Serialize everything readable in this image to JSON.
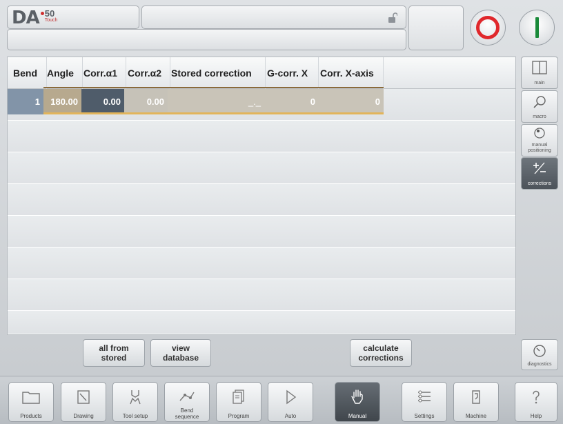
{
  "header": {
    "logo_text": "DA",
    "logo_model": "50",
    "logo_sub": "Touch",
    "title": "",
    "status": "",
    "lock_icon": "unlocked-padlock-icon",
    "stop_icon": "stop-ring-icon",
    "start_icon": "start-bar-icon",
    "colors": {
      "stop": "#e0282c",
      "start": "#1a8a3a"
    }
  },
  "table": {
    "columns": [
      "Bend",
      "Angle",
      "Corr.α1",
      "Corr.α2",
      "Stored correction",
      "G-corr. X",
      "Corr. X-axis"
    ],
    "rows": [
      {
        "bend": "1",
        "angle": "180.00",
        "corr_a1": "0.00",
        "corr_a2": "0.00",
        "stored": "_._",
        "gcorr_x": "0",
        "corr_x": "0"
      }
    ]
  },
  "actions": {
    "all_from_stored": "all from\nstored",
    "view_database": "view\ndatabase",
    "calculate_corrections": "calculate\ncorrections"
  },
  "sidebar": [
    {
      "label": "main",
      "icon": "main-panel-icon",
      "active": false
    },
    {
      "label": "macro",
      "icon": "magnifier-icon",
      "active": false
    },
    {
      "label": "manual positioning",
      "icon": "manual-positioning-icon",
      "active": false
    },
    {
      "label": "corrections",
      "icon": "plus-minus-icon",
      "active": true
    },
    {
      "label": "diagnostics",
      "icon": "diagnostics-gauge-icon",
      "active": false
    }
  ],
  "nav": [
    {
      "label": "Products",
      "icon": "folder-icon",
      "active": false
    },
    {
      "label": "Drawing",
      "icon": "drawing-icon",
      "active": false
    },
    {
      "label": "Tool setup",
      "icon": "tool-setup-icon",
      "active": false
    },
    {
      "label": "Bend sequence",
      "icon": "bend-sequence-icon",
      "active": false
    },
    {
      "label": "Program",
      "icon": "program-icon",
      "active": false
    },
    {
      "label": "Auto",
      "icon": "play-icon",
      "active": false
    },
    {
      "label": "Manual",
      "icon": "hand-icon",
      "active": true
    },
    {
      "label": "Settings",
      "icon": "settings-list-icon",
      "active": false
    },
    {
      "label": "Machine",
      "icon": "machine-icon",
      "active": false
    },
    {
      "label": "Help",
      "icon": "help-icon",
      "active": false
    }
  ]
}
